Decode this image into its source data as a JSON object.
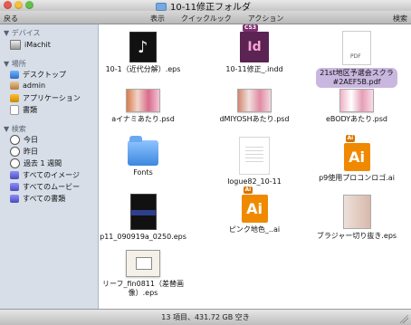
{
  "window": {
    "title": "10-11修正フォルダ_",
    "status": "13 項目、431.72 GB 空き"
  },
  "toolbar": {
    "back": "戻る",
    "view": "表示",
    "quicklook": "クイックルック",
    "action": "アクション",
    "search": "検索"
  },
  "sidebar": {
    "devices_heading": "デバイス",
    "places_heading": "場所",
    "search_heading": "検索",
    "items": [
      "iMachit",
      "デスクトップ",
      "admin",
      "アプリケーション",
      "書類",
      "今日",
      "昨日",
      "過去 1 週間",
      "すべてのイメージ",
      "すべてのムービー",
      "すべての書類"
    ]
  },
  "files": [
    "10-1（近代分解）.eps",
    "10-11修正_.indd",
    "21st地区予選会スクラ\n#2AEF5B.pdf",
    "aイナミあたり.psd",
    "dMIYOSHあたり.psd",
    "eBODYあたり.psd",
    "Fonts",
    "logue82_10-11",
    "p9使用プロコンロゴ.ai",
    "p11_090919a_0250.eps",
    "ピンク地色_..ai",
    "ブラジャー切り抜き.eps",
    "リーフ_fin0811（差替画\n像）.eps"
  ],
  "colors": {
    "selection": "#c9b7df",
    "sidebar": "#d7dee8",
    "folder": "#3d88df"
  }
}
